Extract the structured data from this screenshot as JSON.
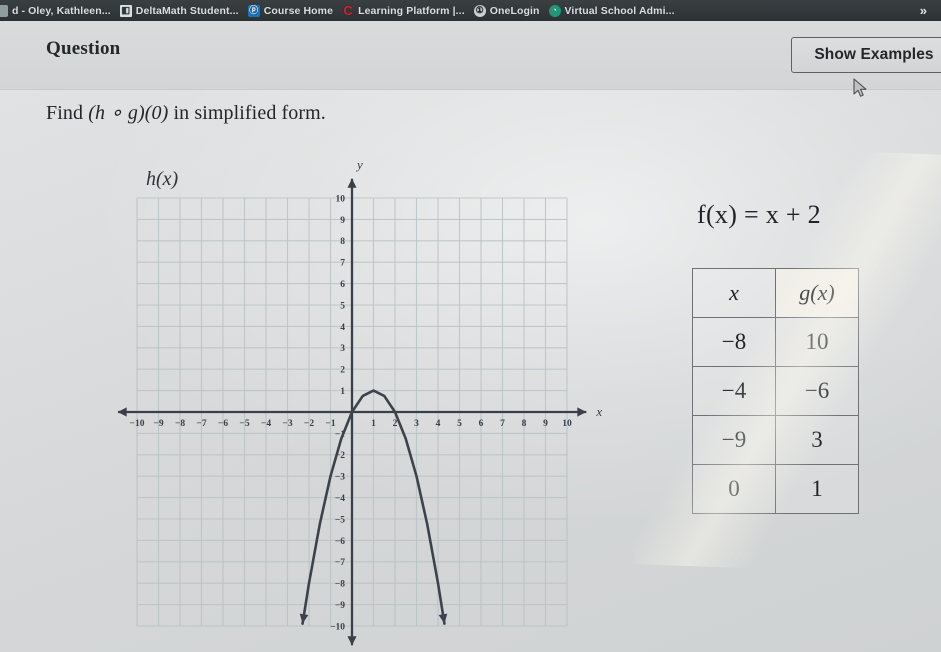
{
  "browser": {
    "tabs": [
      {
        "label": "d - Oley, Kathleen...",
        "icon": "blank-favicon",
        "icon_class": "fav-blank",
        "glyph": ""
      },
      {
        "label": "DeltaMath Student...",
        "icon": "deltamath-favicon",
        "icon_class": "fav-deltamath",
        "glyph": "◧"
      },
      {
        "label": "Course Home",
        "icon": "course-home-favicon",
        "icon_class": "fav-coursehome",
        "glyph": "ⓟ"
      },
      {
        "label": "Learning Platform |...",
        "icon": "learning-platform-favicon",
        "icon_class": "fav-learning",
        "glyph": "C"
      },
      {
        "label": "OneLogin",
        "icon": "onelogin-favicon",
        "icon_class": "fav-onelogin",
        "glyph": "①"
      },
      {
        "label": "Virtual School Admi...",
        "icon": "virtual-school-favicon",
        "icon_class": "fav-vsa",
        "glyph": "◔"
      }
    ],
    "overflow_label": "»"
  },
  "header": {
    "title": "Question",
    "show_examples_label": "Show Examples"
  },
  "question": {
    "prefix": "Find ",
    "composition": "(h ∘ g)(0)",
    "suffix": " in simplified form."
  },
  "graph": {
    "function_label": "h(x)",
    "x_axis_label": "x",
    "y_axis_label": "y",
    "x_ticks": [
      -10,
      -9,
      -8,
      -7,
      -6,
      -5,
      -4,
      -3,
      -2,
      -1,
      1,
      2,
      3,
      4,
      5,
      6,
      7,
      8,
      9,
      10
    ],
    "y_ticks": [
      10,
      9,
      8,
      7,
      6,
      5,
      4,
      3,
      2,
      1,
      -1,
      -2,
      -3,
      -4,
      -5,
      -6,
      -7,
      -8,
      -9,
      -10
    ]
  },
  "chart_data": {
    "type": "line",
    "title": "h(x)",
    "xlabel": "x",
    "ylabel": "y",
    "xlim": [
      -10,
      10
    ],
    "ylim": [
      -10,
      10
    ],
    "grid": true,
    "legend": "none",
    "series": [
      {
        "name": "h(x)",
        "form": "downward parabola",
        "vertex": [
          1,
          1
        ],
        "roots": [
          0,
          2
        ],
        "equation": "h(x) = -(x - 1)^2 + 1",
        "x": [
          -2.3,
          -2,
          -1.5,
          -1,
          -0.5,
          0,
          0.5,
          1,
          1.5,
          2,
          2.5,
          3,
          3.5,
          4,
          4.3
        ],
        "y": [
          -9.89,
          -8,
          -5.25,
          -3,
          -1.25,
          0,
          0.75,
          1,
          0.75,
          0,
          -1.25,
          -3,
          -5.25,
          -8,
          -9.89
        ]
      }
    ]
  },
  "fx": {
    "expression": "f(x) = x + 2"
  },
  "g_table": {
    "headers": [
      "x",
      "g(x)"
    ],
    "rows": [
      [
        "−8",
        "10"
      ],
      [
        "−4",
        "−6"
      ],
      [
        "−9",
        "3"
      ],
      [
        "0",
        "1"
      ]
    ]
  },
  "colors": {
    "page_background": "#d8dadb",
    "tabstrip_background": "#33383b",
    "curve_color": "#3c434c",
    "axis_color": "#3a4049",
    "grid_color": "#b9c3c5",
    "text_color": "#22262a"
  }
}
